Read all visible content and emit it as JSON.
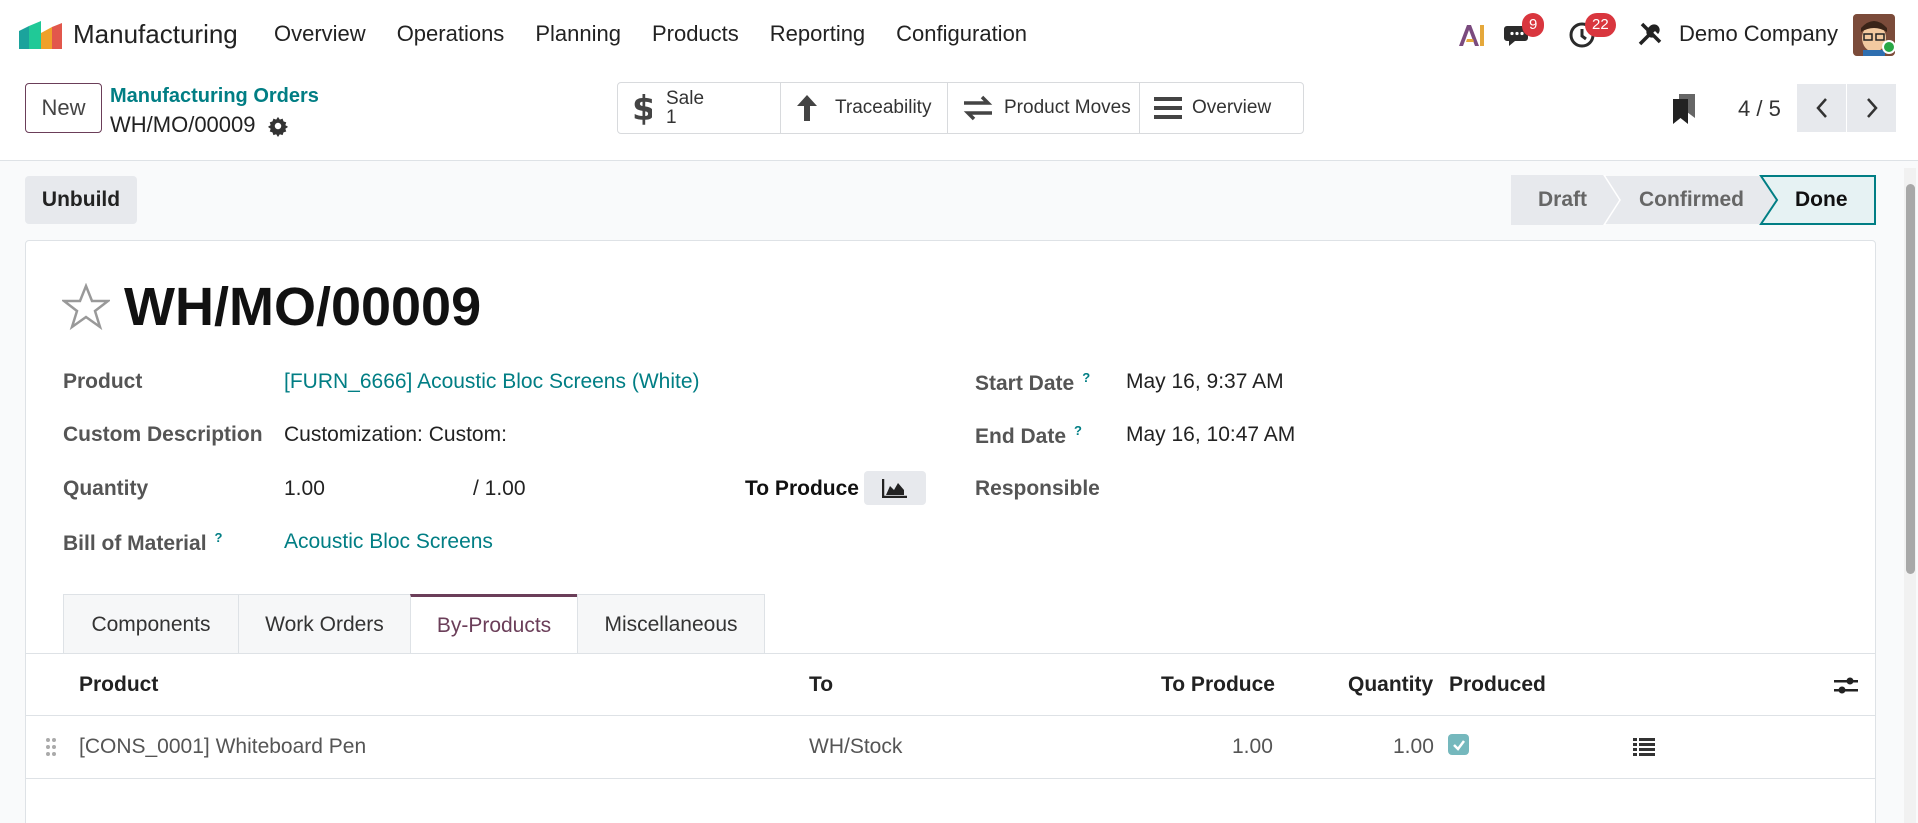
{
  "navbar": {
    "app_name": "Manufacturing",
    "menu": [
      "Overview",
      "Operations",
      "Planning",
      "Products",
      "Reporting",
      "Configuration"
    ],
    "chat_badge": "9",
    "activity_badge": "22",
    "company": "Demo Company"
  },
  "control": {
    "new_label": "New",
    "breadcrumb_parent": "Manufacturing Orders",
    "breadcrumb_current": "WH/MO/00009",
    "smart_buttons": {
      "sale_label": "Sale",
      "sale_count": "1",
      "traceability": "Traceability",
      "product_moves": "Product Moves",
      "overview": "Overview"
    },
    "pager": "4 / 5"
  },
  "actions": {
    "unbuild": "Unbuild"
  },
  "status": {
    "stages": [
      "Draft",
      "Confirmed",
      "Done"
    ],
    "current": "Done"
  },
  "form": {
    "title": "WH/MO/00009",
    "product_label": "Product",
    "product_value": "[FURN_6666] Acoustic Bloc Screens (White)",
    "custom_desc_label": "Custom Description",
    "custom_desc_value": "Customization: Custom:",
    "quantity_label": "Quantity",
    "quantity_value": "1.00",
    "quantity_total": "/ 1.00",
    "to_produce_label": "To Produce",
    "bom_label": "Bill of Material",
    "bom_value": "Acoustic Bloc Screens",
    "start_label": "Start Date",
    "start_value": "May 16, 9:37 AM",
    "end_label": "End Date",
    "end_value": "May 16, 10:47 AM",
    "responsible_label": "Responsible",
    "help_mark": "?"
  },
  "tabs": [
    "Components",
    "Work Orders",
    "By-Products",
    "Miscellaneous"
  ],
  "active_tab": "By-Products",
  "table": {
    "headers": {
      "product": "Product",
      "to": "To",
      "to_produce": "To Produce",
      "quantity": "Quantity",
      "produced": "Produced"
    },
    "rows": [
      {
        "product": "[CONS_0001] Whiteboard Pen",
        "to": "WH/Stock",
        "to_produce": "1.00",
        "quantity": "1.00",
        "produced": true
      }
    ]
  },
  "colors": {
    "brand": "#6b3e59",
    "link": "#017e84",
    "badge": "#d9363e"
  }
}
